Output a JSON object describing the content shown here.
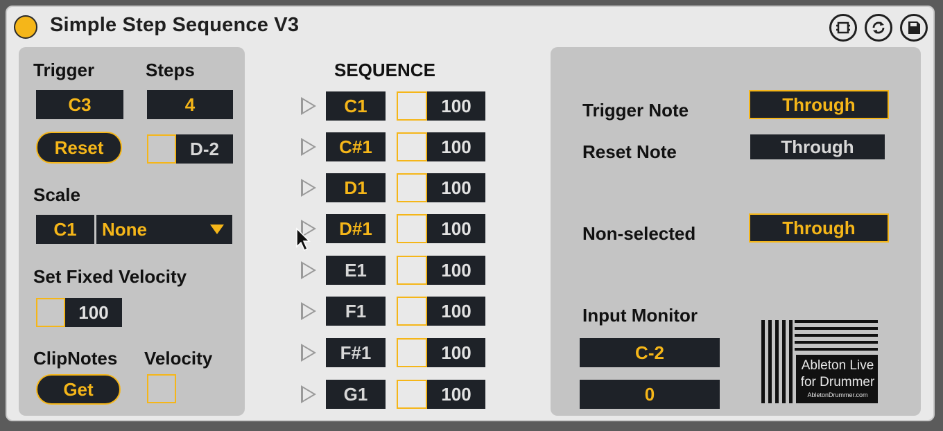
{
  "title": "Simple Step Sequence V3",
  "colors": {
    "accent": "#f5b619",
    "dark": "#1e2228",
    "panel": "#c4c4c4",
    "bg": "#e9e9e9"
  },
  "titlebar_icons": [
    "device-map-icon",
    "refresh-icon",
    "save-icon"
  ],
  "left": {
    "trigger_label": "Trigger",
    "steps_label": "Steps",
    "trigger_value": "C3",
    "steps_value": "4",
    "reset_label": "Reset",
    "reset_note_value": "D-2",
    "scale_label": "Scale",
    "scale_root": "C1",
    "scale_type": "None",
    "fixed_velocity_label": "Set Fixed Velocity",
    "fixed_velocity_value": "100",
    "clipnotes_label": "ClipNotes",
    "velocity_label": "Velocity",
    "get_label": "Get"
  },
  "sequence": {
    "header": "SEQUENCE",
    "steps": [
      {
        "note": "C1",
        "velocity": "100",
        "highlight": true
      },
      {
        "note": "C#1",
        "velocity": "100",
        "highlight": true
      },
      {
        "note": "D1",
        "velocity": "100",
        "highlight": true
      },
      {
        "note": "D#1",
        "velocity": "100",
        "highlight": true
      },
      {
        "note": "E1",
        "velocity": "100",
        "highlight": false
      },
      {
        "note": "F1",
        "velocity": "100",
        "highlight": false
      },
      {
        "note": "F#1",
        "velocity": "100",
        "highlight": false
      },
      {
        "note": "G1",
        "velocity": "100",
        "highlight": false
      }
    ]
  },
  "right": {
    "trigger_note_label": "Trigger Note",
    "trigger_note_value": "Through",
    "reset_note_label": "Reset Note",
    "reset_note_value": "Through",
    "non_selected_label": "Non-selected",
    "non_selected_value": "Through",
    "input_monitor_label": "Input Monitor",
    "input_monitor_note": "C-2",
    "input_monitor_velocity": "0"
  },
  "logo": {
    "line1": "Ableton Live",
    "line2": "for Drummer",
    "line3": "AbletonDrummer.com"
  }
}
